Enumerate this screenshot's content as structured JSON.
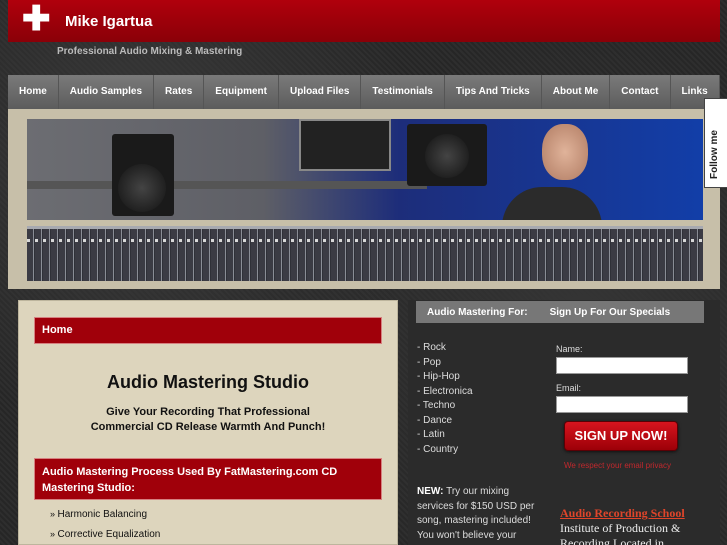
{
  "site": {
    "title": "Mike Igartua",
    "tagline": "Professional Audio Mixing & Mastering",
    "logo_glyph": "✚"
  },
  "nav": {
    "items": [
      {
        "label": "Home"
      },
      {
        "label": "Audio Samples"
      },
      {
        "label": "Rates"
      },
      {
        "label": "Equipment"
      },
      {
        "label": "Upload Files"
      },
      {
        "label": "Testimonials"
      },
      {
        "label": "Tips And Tricks"
      },
      {
        "label": "About Me"
      },
      {
        "label": "Contact"
      },
      {
        "label": "Links"
      }
    ]
  },
  "follow": {
    "label": "Follow me"
  },
  "main": {
    "breadcrumb": "Home",
    "title": "Audio Mastering Studio",
    "subtitle_line1": "Give Your Recording That Professional",
    "subtitle_line2": "Commercial CD Release Warmth And Punch!",
    "process_heading": "Audio Mastering Process Used By FatMastering.com CD Mastering Studio:",
    "process_items": [
      "Harmonic Balancing",
      "Corrective Equalization"
    ]
  },
  "sidebar": {
    "tab_mastering": "Audio Mastering For:",
    "tab_signup": "Sign Up For Our Specials",
    "genres": [
      "- Rock",
      "- Pop",
      "- Hip-Hop",
      "- Electronica",
      "- Techno",
      "- Dance",
      "- Latin",
      "- Country"
    ],
    "new_label": "NEW:",
    "new_text": "Try our mixing services for $150 USD per song, mastering included! You won't believe your",
    "form": {
      "name_label": "Name:",
      "email_label": "Email:",
      "name_value": "",
      "email_value": "",
      "submit_label": "SIGN UP NOW!",
      "privacy": "We respect your email privacy"
    },
    "school_link": "Audio Recording School",
    "school_text": "Institute of Production & Recording Located in"
  },
  "colors": {
    "accent_red": "#a0000a",
    "panel_beige": "#ddd5bd",
    "nav_gray": "#6b6b6b"
  }
}
